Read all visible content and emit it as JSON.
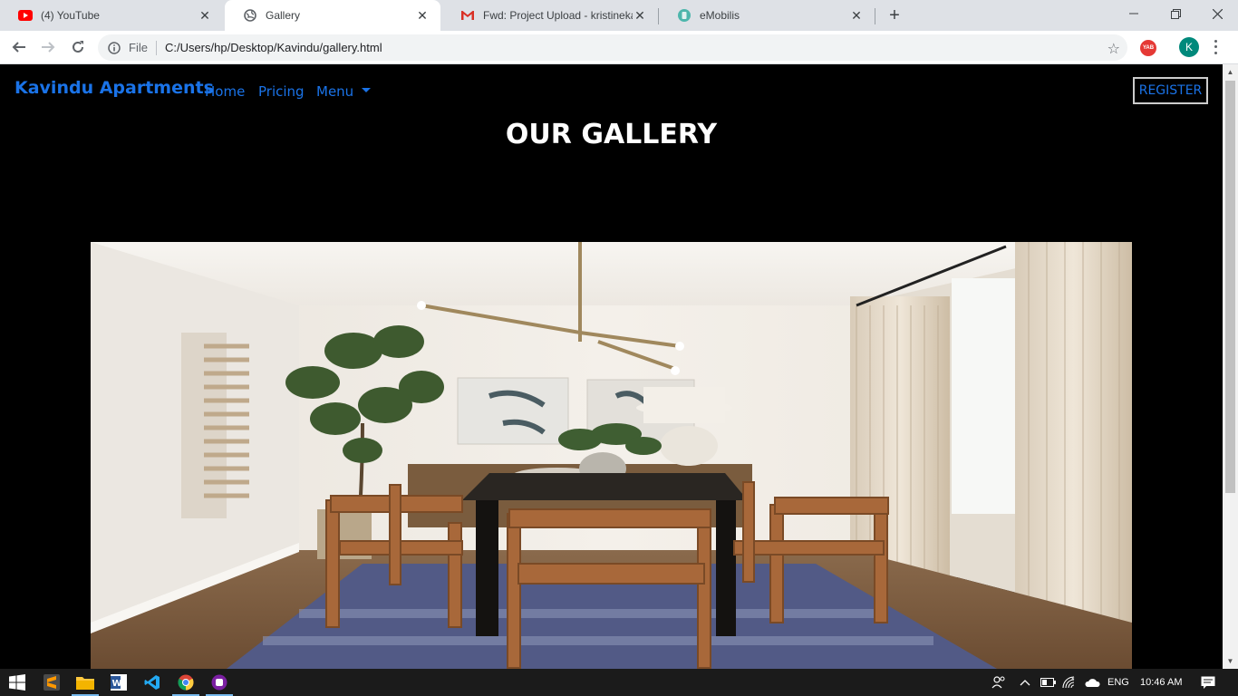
{
  "browser": {
    "tabs": [
      {
        "title": "(4) YouTube",
        "icon": "youtube-icon",
        "active": false
      },
      {
        "title": "Gallery",
        "icon": "globe-icon",
        "active": true
      },
      {
        "title": "Fwd: Project Upload - kristinekak",
        "icon": "gmail-icon",
        "active": false
      },
      {
        "title": "eMobilis",
        "icon": "emobilis-icon",
        "active": false
      }
    ],
    "address": {
      "scheme_label": "File",
      "url": "C:/Users/hp/Desktop/Kavindu/gallery.html"
    },
    "extension_label": "YAB",
    "profile_initial": "K"
  },
  "page": {
    "brand": "Kavindu Apartments",
    "nav": [
      {
        "label": "Home"
      },
      {
        "label": "Pricing"
      },
      {
        "label": "Menu"
      }
    ],
    "register_label": "REGISTER",
    "title": "OUR GALLERY",
    "accent_color": "#1a73e8"
  },
  "taskbar": {
    "language": "ENG",
    "time": "10:46 AM"
  }
}
